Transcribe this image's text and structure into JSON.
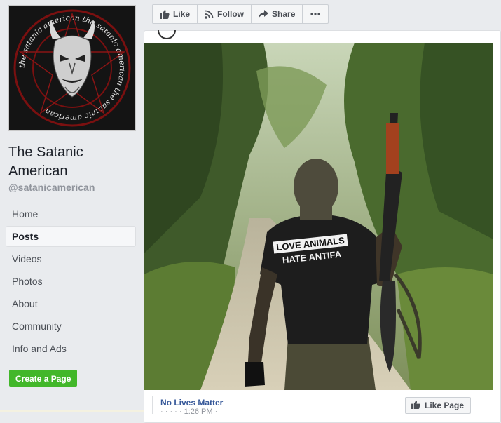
{
  "page": {
    "name": "The Satanic American",
    "handle": "@satanicamerican"
  },
  "profile_logo": {
    "ring_text": "the satanic american the satanic american the satanic american"
  },
  "nav": {
    "items": [
      {
        "label": "Home"
      },
      {
        "label": "Posts"
      },
      {
        "label": "Videos"
      },
      {
        "label": "Photos"
      },
      {
        "label": "About"
      },
      {
        "label": "Community"
      },
      {
        "label": "Info and Ads"
      }
    ],
    "active": "Posts"
  },
  "create_page_label": "Create a Page",
  "actions": {
    "like": "Like",
    "follow": "Follow",
    "share": "Share",
    "more_icon": "ellipsis-icon"
  },
  "post": {
    "shirt_line1": "LOVE ANIMALS",
    "shirt_line2": "HATE ANTIFA",
    "link_title": "No Lives Matter",
    "link_sub": "· · · · · 1:26 PM ·",
    "like_page_label": "Like Page"
  },
  "colors": {
    "accent_blue": "#365899",
    "create_green": "#42b72a",
    "background": "#e9ebee"
  }
}
